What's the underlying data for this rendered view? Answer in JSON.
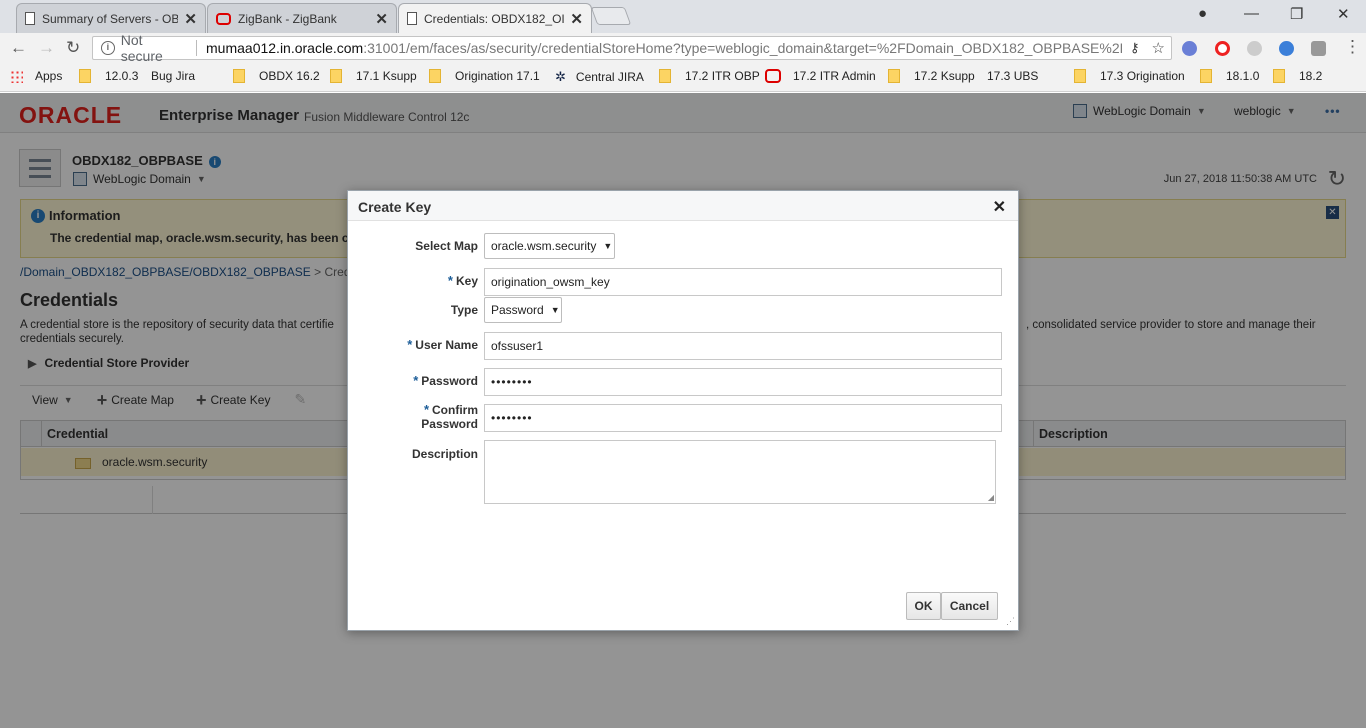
{
  "browser": {
    "tabs": [
      {
        "title": "Summary of Servers - OB",
        "icon": "page-icon"
      },
      {
        "title": "ZigBank - ZigBank",
        "icon": "oracle-icon"
      },
      {
        "title": "Credentials: OBDX182_OI",
        "icon": "page-icon"
      }
    ],
    "address": {
      "security_label": "Not secure",
      "url_host": "mumaa012.in.oracle.com",
      "url_rest": ":31001/em/faces/as/security/credentialStoreHome?type=weblogic_domain&target=%2FDomain_OBDX182_OBPBASE%2F..."
    },
    "bookmarks": [
      {
        "label": "Apps",
        "icon": "apps-icon"
      },
      {
        "label": "12.0.3",
        "icon": "folder-icon"
      },
      {
        "label": "Bug Jira",
        "icon": "page-icon"
      },
      {
        "label": "OBDX 16.2",
        "icon": "folder-icon"
      },
      {
        "label": "17.1 Ksupp",
        "icon": "folder-icon"
      },
      {
        "label": "Origination 17.1",
        "icon": "folder-icon"
      },
      {
        "label": "Central JIRA",
        "icon": "jira-icon"
      },
      {
        "label": "17.2 ITR OBP",
        "icon": "folder-icon"
      },
      {
        "label": "17.2 ITR Admin",
        "icon": "oracle-icon"
      },
      {
        "label": "17.2 Ksupp",
        "icon": "folder-icon"
      },
      {
        "label": "17.3 UBS",
        "icon": "page-icon"
      },
      {
        "label": "17.3 Origination",
        "icon": "folder-icon"
      },
      {
        "label": "18.1.0",
        "icon": "folder-icon"
      },
      {
        "label": "18.2",
        "icon": "folder-icon"
      }
    ]
  },
  "em": {
    "logo": "ORACLE",
    "product": "Enterprise Manager",
    "product_sub": "Fusion Middleware Control 12c",
    "domain_menu": "WebLogic Domain",
    "user_menu": "weblogic",
    "target_name": "OBDX182_OBPBASE",
    "target_type": "WebLogic Domain",
    "timestamp": "Jun 27, 2018 11:50:38 AM UTC",
    "info_title": "Information",
    "info_message": "The credential map, oracle.wsm.security, has been c",
    "breadcrumb": "/Domain_OBDX182_OBPBASE/OBDX182_OBPBASE",
    "breadcrumb_rest": " > Cred",
    "page_title": "Credentials",
    "desc_left": "A credential store is the repository of security data that certifie",
    "desc_right": ", consolidated service provider to store and manage their",
    "desc_line2": "credentials securely.",
    "credential_store_provider": "Credential Store Provider",
    "toolbar": {
      "view": "View",
      "create_map": "Create Map",
      "create_key": "Create Key"
    },
    "table": {
      "headers": [
        "Credential",
        "Description"
      ],
      "rows": [
        {
          "name": "oracle.wsm.security",
          "description": ""
        }
      ]
    }
  },
  "dialog": {
    "title": "Create Key",
    "select_map_label": "Select Map",
    "select_map_value": "oracle.wsm.security",
    "key_label": "Key",
    "key_value": "origination_owsm_key",
    "type_label": "Type",
    "type_value": "Password",
    "username_label": "User Name",
    "username_value": "ofssuser1",
    "password_label": "Password",
    "password_value": "••••••••",
    "confirm_label_1": "Confirm",
    "confirm_label_2": "Password",
    "confirm_value": "••••••••",
    "description_label": "Description",
    "description_value": "",
    "ok_label": "OK",
    "cancel_label": "Cancel",
    "required_marker": "*"
  },
  "colors": {
    "oracle_red": "#e2211c",
    "info_bg": "#fff9d6",
    "link_blue": "#1a4e87"
  }
}
